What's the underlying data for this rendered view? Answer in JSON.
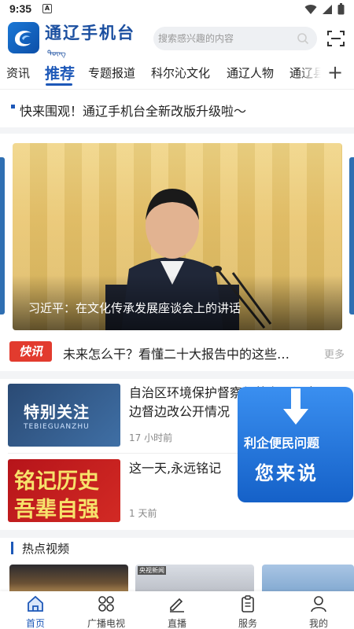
{
  "status_bar": {
    "time": "9:35",
    "indicator": "A"
  },
  "header": {
    "app_name": "通辽手机台",
    "search_placeholder": "搜索感兴趣的内容"
  },
  "tabs": [
    "资讯",
    "推荐",
    "专题报道",
    "科尔沁文化",
    "通辽人物",
    "通辽县"
  ],
  "active_tab": "推荐",
  "notice": "快来围观！通辽手机台全新改版升级啦～",
  "banner": {
    "caption": "习近平：在文化传承发展座谈会上的讲话"
  },
  "flash": {
    "badge": "快讯",
    "text": "未来怎么干？看懂二十大报告中的这些…",
    "more": "更多"
  },
  "news": [
    {
      "title": "自治区环境保护督察组将在通辽市开展边督边改公开情况",
      "time": "17 小时前",
      "thumb_text": "特别关注",
      "thumb_sub": "TEBIEGUANZHU"
    },
    {
      "title": "这一天,永远铭记",
      "time": "1 天前",
      "thumb_text_1": "铭记历史",
      "thumb_text_2": "吾辈自强"
    }
  ],
  "promo": {
    "line1": "利企便民问题",
    "line2": "您来说"
  },
  "hot_videos": {
    "title": "热点视频",
    "vid2_label": "央视新闻"
  },
  "bottom_nav": [
    {
      "label": "首页",
      "icon": "home-icon"
    },
    {
      "label": "广播电视",
      "icon": "grid-icon"
    },
    {
      "label": "直播",
      "icon": "live-icon"
    },
    {
      "label": "服务",
      "icon": "clipboard-icon"
    },
    {
      "label": "我的",
      "icon": "user-icon"
    }
  ],
  "colors": {
    "accent": "#1d58b8",
    "flash_red": "#e23b2e"
  }
}
